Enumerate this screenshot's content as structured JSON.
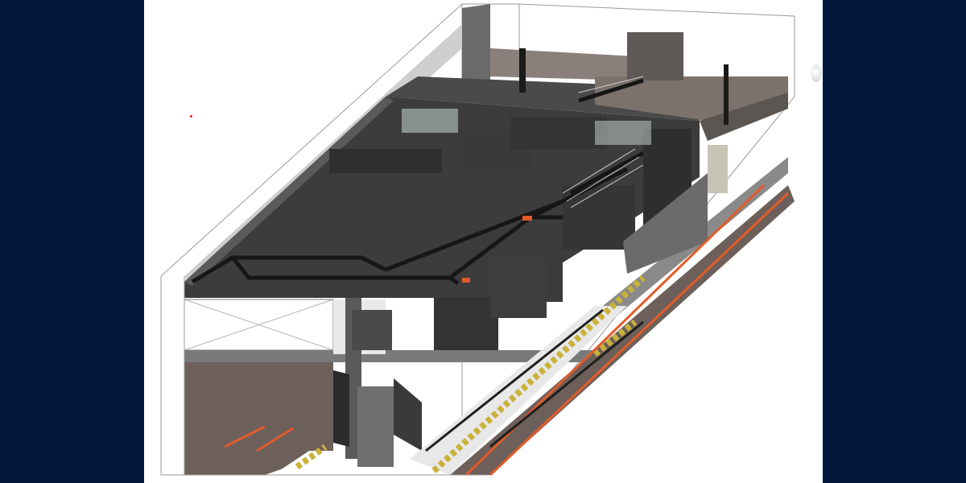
{
  "window": {
    "background_color": "#01183a",
    "viewport_background": "#ffffff"
  },
  "model_view": {
    "view_type": "3d-isometric",
    "subject": "bim-station-model",
    "colors": {
      "slab": "#3c3c3c",
      "slab_light": "#7a7a7a",
      "wall": "#5a5a5a",
      "duct": "#2a2a2a",
      "platform_edge": "#c9b23a",
      "rail_stripe": "#e25b2a",
      "floor": "#6d605a",
      "section_line": "#9a9a9a",
      "marker": "#e02020"
    }
  },
  "navigation": {
    "view_cube_icon": "view-cube-icon"
  }
}
